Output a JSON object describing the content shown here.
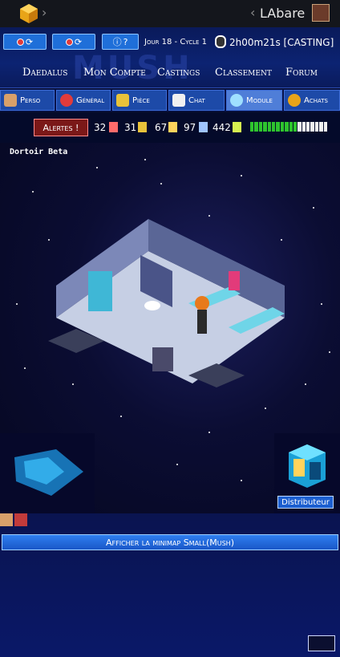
{
  "topbar": {
    "username": "LAbare",
    "logo_icon": "cube-logo-icon",
    "avatar_icon": "user-avatar-icon"
  },
  "header": {
    "button1_icon": "pill-refresh-icon",
    "button2_icon": "pill-refresh-icon",
    "help_label": "?",
    "cycle_text": "Jour 18 - Cycle 1",
    "timer_text": "2h00m21s [CASTING]",
    "nav": [
      "Daedalus",
      "Mon Compte",
      "Castings",
      "Classement",
      "Forum"
    ]
  },
  "tabs": [
    "Perso",
    "Général",
    "Pièce",
    "Chat",
    "Module",
    "Achats"
  ],
  "active_tab": "Module",
  "status": {
    "alerts_label": "Alertes !",
    "stats": [
      "32",
      "31",
      "67",
      "97",
      "442"
    ],
    "morale_total": 18,
    "morale_filled": 11
  },
  "game": {
    "room_name": "Dortoir Beta",
    "distributor_label": "Distributeur"
  },
  "bottom": {
    "minimap_button": "Afficher la minimap Small(Mush)"
  },
  "colors": {
    "accent": "#1f6fd9",
    "alert": "#7b1818",
    "morale": "#2ec42e"
  }
}
